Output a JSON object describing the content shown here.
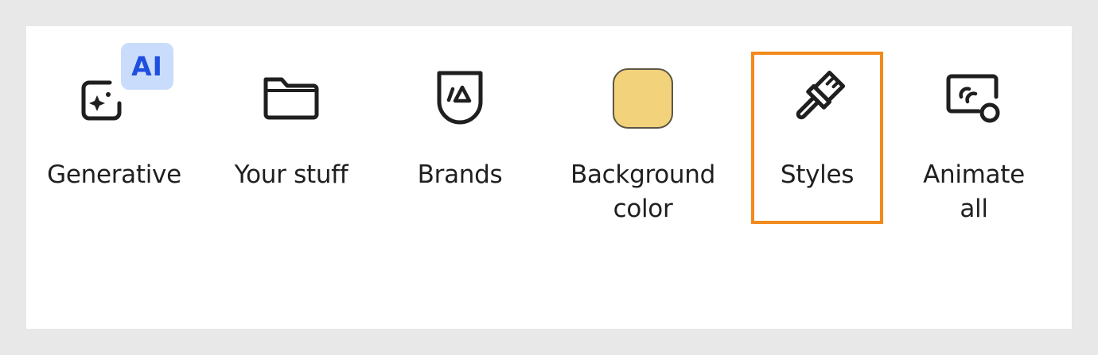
{
  "toolbar": {
    "items": [
      {
        "id": "generative",
        "label": "Generative",
        "icon": "generative-icon",
        "badge": "AI"
      },
      {
        "id": "your-stuff",
        "label": "Your stuff",
        "icon": "folder-icon"
      },
      {
        "id": "brands",
        "label": "Brands",
        "icon": "brand-shield-icon"
      },
      {
        "id": "background-color",
        "label": "Background\ncolor",
        "icon": "color-swatch",
        "swatch_color": "#f2d27a"
      },
      {
        "id": "styles",
        "label": "Styles",
        "icon": "paintbrush-icon",
        "selected": true
      },
      {
        "id": "animate-all",
        "label": "Animate\nall",
        "icon": "animate-icon"
      }
    ]
  },
  "colors": {
    "selection_outline": "#f18a1c",
    "ai_badge_bg": "#c9dcfb",
    "ai_badge_text": "#1f4fe0",
    "swatch": "#f2d27a"
  }
}
